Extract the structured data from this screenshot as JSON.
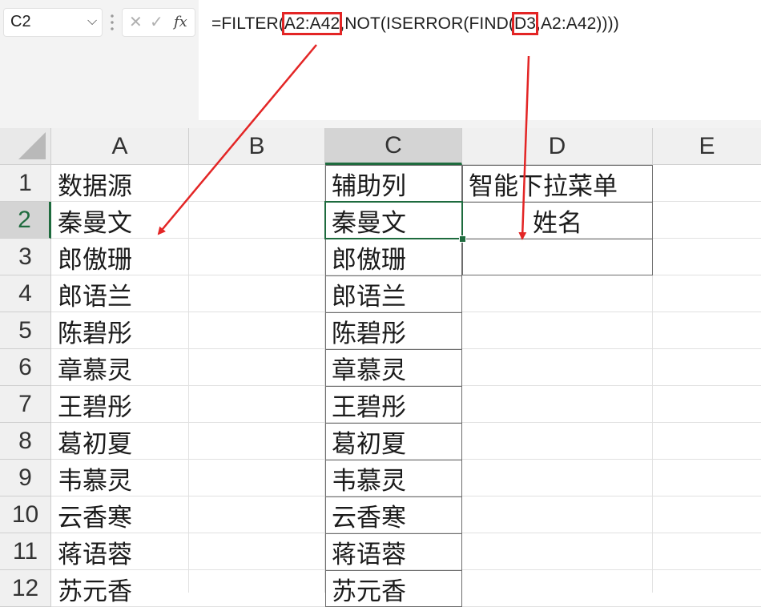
{
  "name_box": {
    "value": "C2"
  },
  "formula_bar": {
    "parts": [
      "=FILTER(",
      "A2:A42",
      ",NOT(ISERROR(FIND(",
      "D3",
      ",A2:A42))))"
    ],
    "fx_label": "fx"
  },
  "columns": [
    "A",
    "B",
    "C",
    "D",
    "E"
  ],
  "rows": [
    "1",
    "2",
    "3",
    "4",
    "5",
    "6",
    "7",
    "8",
    "9",
    "10",
    "11",
    "12"
  ],
  "cells": {
    "A": [
      "数据源",
      "秦曼文",
      "郎傲珊",
      "郎语兰",
      "陈碧彤",
      "章慕灵",
      "王碧彤",
      "葛初夏",
      "韦慕灵",
      "云香寒",
      "蒋语蓉",
      "苏元香"
    ],
    "C": [
      "辅助列",
      "秦曼文",
      "郎傲珊",
      "郎语兰",
      "陈碧彤",
      "章慕灵",
      "王碧彤",
      "葛初夏",
      "韦慕灵",
      "云香寒",
      "蒋语蓉",
      "苏元香"
    ],
    "D1": "智能下拉菜单",
    "D2": "姓名",
    "D3": ""
  },
  "selection": {
    "active_cell": "C2"
  },
  "annotation_color": "#e32525",
  "accent_color": "#1e6b3e"
}
